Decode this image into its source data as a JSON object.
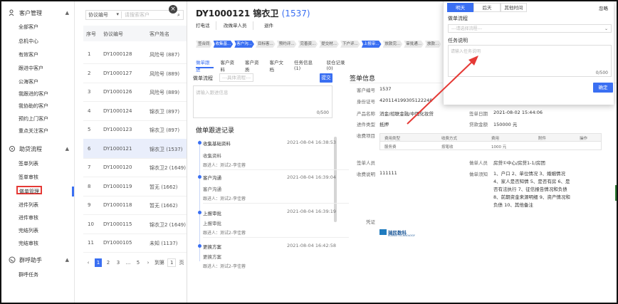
{
  "sidebar": {
    "groups": [
      {
        "label": "客户管理",
        "icon": "users-icon"
      },
      {
        "label": "助贷流程",
        "icon": "workflow-icon"
      },
      {
        "label": "群呼助手",
        "icon": "phone-icon"
      }
    ],
    "customer_items": [
      "全部客户",
      "总机中心",
      "有效客户",
      "跟进中客户",
      "公海客户",
      "我跟进的客户",
      "我协助的客户",
      "预约上门客户",
      "重点关注客户"
    ],
    "process_items": [
      "签单列表",
      "签单审核",
      "做单管理",
      "进件列表",
      "进件审核",
      "完结列表",
      "完结审核"
    ],
    "phone_items": [
      "群呼任务"
    ],
    "active_item": "做单管理"
  },
  "list": {
    "search_select": "协议编号",
    "search_placeholder": "请搜索客户",
    "columns": [
      "序号",
      "协议编号",
      "客户姓名"
    ],
    "rows": [
      [
        "1",
        "DY1000128",
        "风险号 (887)"
      ],
      [
        "2",
        "DY1000127",
        "风险号 (889)"
      ],
      [
        "3",
        "DY1000126",
        "风险号 (889)"
      ],
      [
        "4",
        "DY1000124",
        "锦衣卫 (897)"
      ],
      [
        "5",
        "DY1000123",
        "锦衣卫 (897)"
      ],
      [
        "6",
        "DY1000121",
        "锦衣卫 (1537)"
      ],
      [
        "7",
        "DY1000120",
        "锦衣卫2 (1649)"
      ],
      [
        "8",
        "DY1000119",
        "暂无 (1662)"
      ],
      [
        "9",
        "DY1000118",
        "暂无 (1662)"
      ],
      [
        "10",
        "DY1000115",
        "锦衣卫2 (1649)"
      ],
      [
        "11",
        "DY1000105",
        "未知 (1137)"
      ]
    ],
    "selected_index": 5,
    "pager": {
      "pages": [
        "1",
        "2",
        "3",
        "...",
        "5"
      ],
      "current": "1",
      "goto_label": "到第",
      "goto_value": "1",
      "page_suffix": "页"
    }
  },
  "detail": {
    "title": "DY1000121",
    "name": "锦衣卫",
    "code": "(1537)",
    "toolbar": [
      "打电话",
      "改做单人员",
      "退件"
    ],
    "steps": [
      "签合同",
      "收集基...",
      "客户沟...",
      "目标客...",
      "预约评...",
      "完善资...",
      "提交材...",
      "下户评...",
      "上报审...",
      "放款完...",
      "审批通...",
      "放款..."
    ],
    "tabs": [
      "做单跟进",
      "客户资料",
      "客户资质",
      "客户文档",
      "任务信息 (1)",
      "驳仓记录 (0)"
    ],
    "form": {
      "label": "做单流程",
      "select_placeholder": "---具体流程---",
      "submit": "提交",
      "textarea_placeholder": "请输入跟进信息",
      "counter": "0/500"
    },
    "records_title": "做单跟进记录",
    "records": [
      {
        "title": "收集基础资料",
        "time": "2021-08-04 16:38:53",
        "text": "收集资料",
        "by": "跟进人：测试2-李佳蓉"
      },
      {
        "title": "客户沟通",
        "time": "2021-08-04 16:39:04",
        "text": "客户沟通",
        "by": "跟进人：测试2-李佳蓉"
      },
      {
        "title": "上报审批",
        "time": "2021-08-04 16:39:19",
        "text": "上报审批",
        "by": "跟进人：测试2-李佳蓉"
      },
      {
        "title": "更换方案",
        "time": "2021-08-04 16:42:58",
        "text": "更换方案",
        "by": "跟进人：测试2-李佳蓉"
      }
    ],
    "sign_title": "签单信息",
    "info": {
      "customer_no_label": "客户编号",
      "customer_no": "1537",
      "id_label": "身份证号",
      "id": "420114199305122248",
      "product_label": "产品名称",
      "product": "消金/招联金融/中国化妆贷",
      "sign_date_label": "签单日期",
      "sign_date": "2021-08-02 15:44:06",
      "loan_type_label": "进件类型",
      "loan_type": "抵押",
      "loan_amount_label": "贷款金额",
      "loan_amount": "150000 元",
      "fee_label": "收费项目",
      "fee_columns": [
        "费用类型",
        "收费方式",
        "费用",
        "附件",
        "操作"
      ],
      "fee_row": [
        "服务费",
        "按笔收",
        "1000 元",
        "",
        ""
      ],
      "signer_label": "签单人员",
      "signer": "",
      "maker_label": "做单人员",
      "maker": "房贷①中心/房贷1-1/房团",
      "fee_note_label": "收费说明",
      "fee_note": "111111",
      "maker_note_label": "做单须知",
      "maker_note": "1、户口 2、单位情况 3、婚姻情况 4、家人是否知情 5、是否有房 6、是否有法执行 7、征信报告情况和负债 8、前期资金来源明细 9、资产情况和负债 10、其他备注",
      "voucher_label": "凭证",
      "logo_text": "瑞民数科",
      "logo_sub": "RUIMIN TECHNOLOGY"
    }
  },
  "popup": {
    "tabs": [
      "明天",
      "后天",
      "其他时间"
    ],
    "active_tab": "明天",
    "ignore": "忽略",
    "flow_label": "做单流程",
    "flow_placeholder": "---请选择流程---",
    "desc_label": "任务说明",
    "desc_placeholder": "请输入任务说明",
    "counter": "0/500",
    "confirm": "确定"
  },
  "colors": {
    "accent": "#3a6ff2",
    "highlight": "#e53935",
    "arrow": "#e53935"
  }
}
